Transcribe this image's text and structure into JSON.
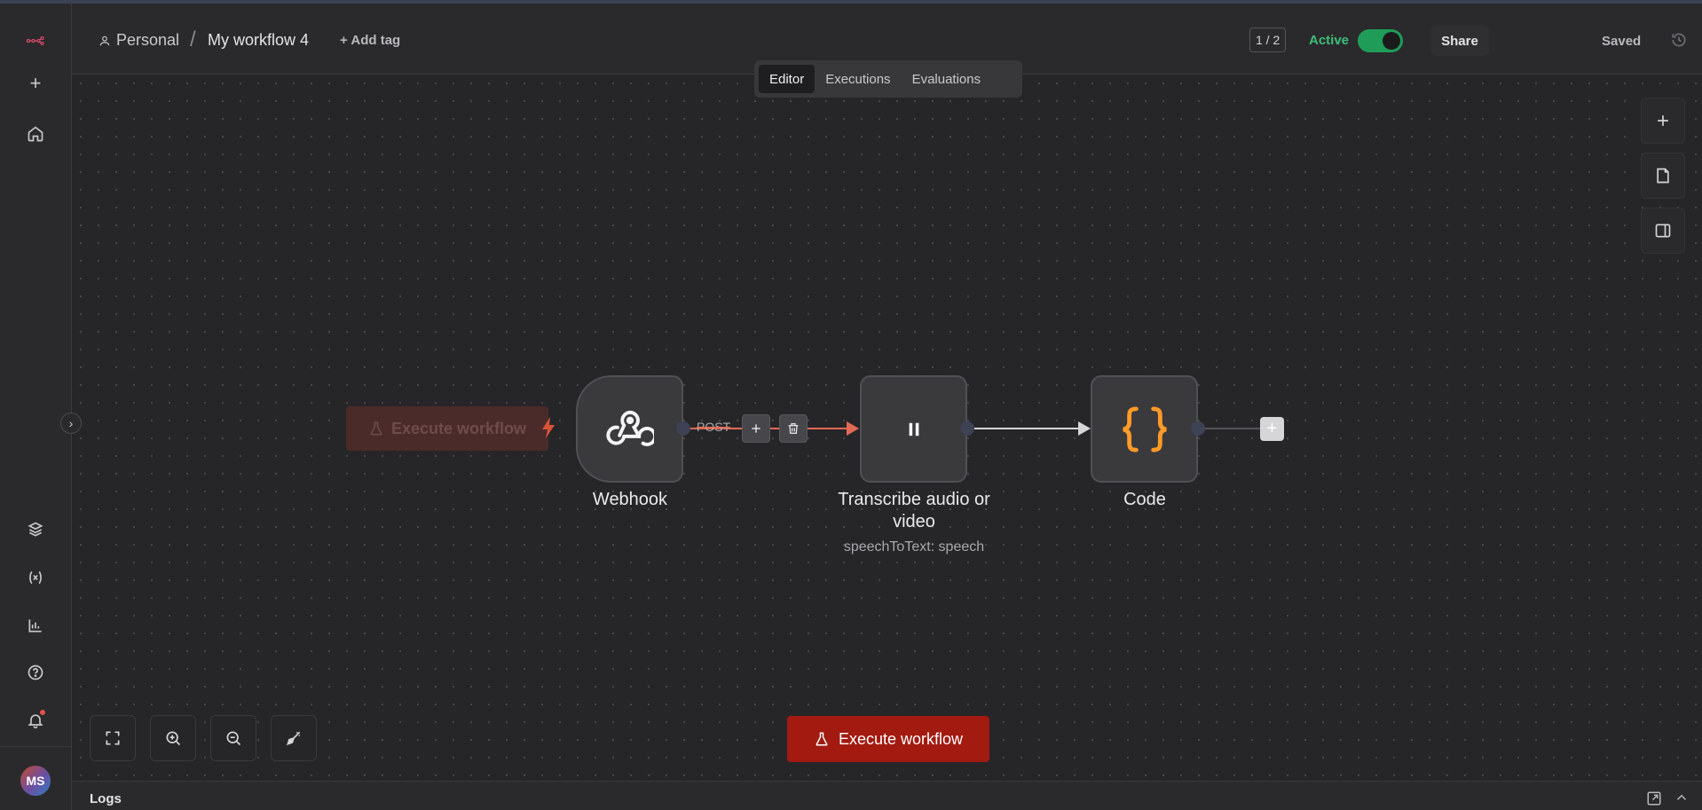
{
  "header": {
    "project": "Personal",
    "separator": "/",
    "workflow_name": "My workflow 4",
    "add_tag": "+ Add tag",
    "counter": "1 / 2",
    "active_label": "Active",
    "active": true,
    "share": "Share",
    "saved": "Saved"
  },
  "tabs": [
    {
      "label": "Editor",
      "active": true
    },
    {
      "label": "Executions",
      "active": false
    },
    {
      "label": "Evaluations",
      "active": false
    }
  ],
  "sidebar": {
    "user_initials": "MS"
  },
  "canvas": {
    "ghost_execute_label": "Execute workflow",
    "connection_label": "POST",
    "nodes": [
      {
        "title": "Webhook",
        "icon": "webhook-icon"
      },
      {
        "title": "Transcribe audio or video",
        "subtitle": "speechToText: speech",
        "icon": "pause-icon"
      },
      {
        "title": "Code",
        "icon": "code-braces-icon"
      }
    ],
    "execute_button": "Execute workflow"
  },
  "logs": {
    "label": "Logs"
  },
  "colors": {
    "accent_red": "#a21a10",
    "active_green": "#3bbf79",
    "connection_red": "#e26a55",
    "code_orange": "#ff9b26"
  }
}
